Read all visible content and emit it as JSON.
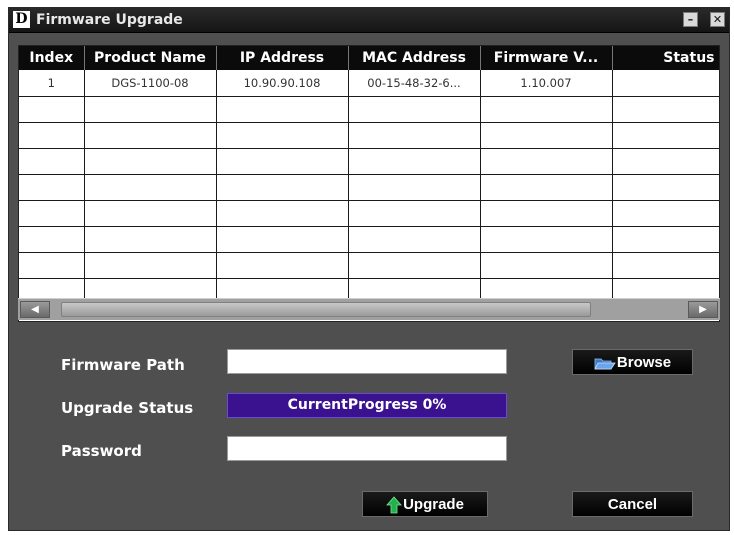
{
  "window": {
    "title": "Firmware Upgrade",
    "logo": "D"
  },
  "titlebar_buttons": {
    "minimize": "–",
    "close": "✕"
  },
  "table": {
    "columns": [
      "Index",
      "Product Name",
      "IP Address",
      "MAC Address",
      "Firmware V...",
      "Status"
    ],
    "rows": [
      [
        "1",
        "DGS-1100-08",
        "10.90.90.108",
        "00-15-48-32-6...",
        "1.10.007",
        ""
      ],
      [
        "",
        "",
        "",
        "",
        "",
        ""
      ],
      [
        "",
        "",
        "",
        "",
        "",
        ""
      ],
      [
        "",
        "",
        "",
        "",
        "",
        ""
      ],
      [
        "",
        "",
        "",
        "",
        "",
        ""
      ],
      [
        "",
        "",
        "",
        "",
        "",
        ""
      ],
      [
        "",
        "",
        "",
        "",
        "",
        ""
      ],
      [
        "",
        "",
        "",
        "",
        "",
        ""
      ],
      [
        "",
        "",
        "",
        "",
        "",
        ""
      ]
    ]
  },
  "scrollbar": {
    "left_arrow": "◀",
    "right_arrow": "▶"
  },
  "form": {
    "firmware_path_label": "Firmware Path",
    "firmware_path_value": "",
    "upgrade_status_label": "Upgrade Status",
    "progress_text": "CurrentProgress 0%",
    "progress_fraction": 0,
    "password_label": "Password",
    "password_value": ""
  },
  "buttons": {
    "browse": "Browse",
    "upgrade": "Upgrade",
    "cancel": "Cancel"
  },
  "icons": {
    "browse": "folder-open-icon",
    "upgrade": "upload-arrow-icon"
  },
  "colors": {
    "progress_bg": "#3a1290",
    "upgrade_arrow": "#22b14c",
    "folder": "#4a8be0"
  }
}
